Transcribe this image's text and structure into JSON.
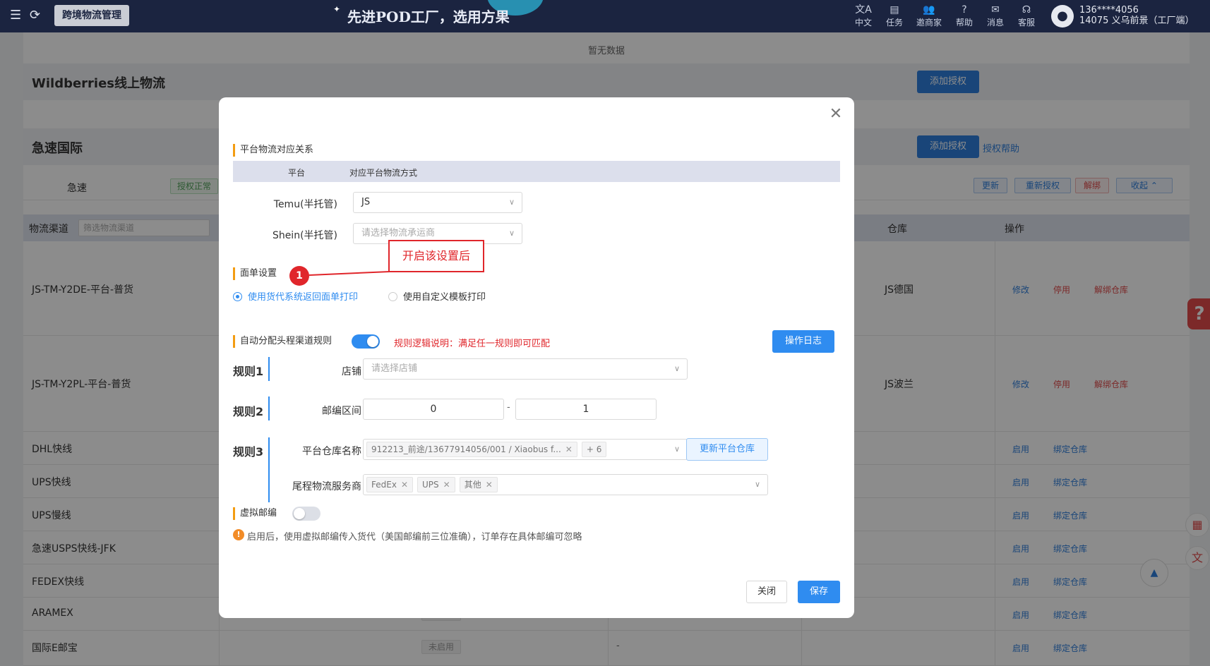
{
  "topbar": {
    "page_tab": "跨境物流管理",
    "banner": "先进POD工厂，选用方果",
    "icons": [
      {
        "name": "language-icon",
        "glyph": "文A",
        "label": "中文"
      },
      {
        "name": "task-icon",
        "glyph": "▤",
        "label": "任务"
      },
      {
        "name": "invite-icon",
        "glyph": "👥",
        "label": "邀商家"
      },
      {
        "name": "help-icon",
        "glyph": "?",
        "label": "帮助"
      },
      {
        "name": "message-icon",
        "glyph": "✉",
        "label": "消息"
      },
      {
        "name": "service-icon",
        "glyph": "☊",
        "label": "客服"
      }
    ],
    "user_phone": "136****4056",
    "user_shop": "14075 义乌前景（工厂端）"
  },
  "background": {
    "nodata": "暂无数据",
    "wildberries_title": "Wildberries线上物流",
    "add_auth": "添加授权",
    "jisu_title": "急速国际",
    "auth_help": "授权帮助",
    "auth_name": "急速",
    "auth_status": "授权正常",
    "btn_update": "更新",
    "btn_reauth": "重新授权",
    "btn_unbind": "解绑",
    "btn_collapse": "收起",
    "col_channel": "物流渠道",
    "filter_placeholder": "筛选物流渠道",
    "col_warehouse": "仓库",
    "col_action": "操作",
    "rows": [
      {
        "name": "JS-TM-Y2DE-平台-普货",
        "warehouse": "JS德国",
        "a1": "修改",
        "a2": "停用",
        "a3": "解绑仓库"
      },
      {
        "name": "JS-TM-Y2PL-平台-普货",
        "warehouse": "JS波兰",
        "a1": "修改",
        "a2": "停用",
        "a3": "解绑仓库"
      },
      {
        "name": "DHL快线",
        "a1": "启用",
        "a2": "绑定仓库"
      },
      {
        "name": "UPS快线",
        "a1": "启用",
        "a2": "绑定仓库"
      },
      {
        "name": "UPS慢线",
        "a1": "启用",
        "a2": "绑定仓库"
      },
      {
        "name": "急速USPS快线-JFK",
        "a1": "启用",
        "a2": "绑定仓库"
      },
      {
        "name": "FEDEX快线",
        "a1": "启用",
        "a2": "绑定仓库"
      },
      {
        "name": "ARAMEX",
        "status": "未启用",
        "dash": "-",
        "a1": "启用",
        "a2": "绑定仓库"
      },
      {
        "name": "国际E邮宝",
        "status": "未启用",
        "dash": "-",
        "a1": "启用",
        "a2": "绑定仓库"
      }
    ]
  },
  "modal": {
    "sec_mapping": "平台物流对应关系",
    "col_platform": "平台",
    "col_method": "对应平台物流方式",
    "temu_label": "Temu(半托管)",
    "temu_value": "JS",
    "shein_label": "Shein(半托管)",
    "shein_placeholder": "请选择物流承运商",
    "sec_label": "面单设置",
    "radio_system": "使用货代系统返回面单打印",
    "radio_custom": "使用自定义模板打印",
    "sec_auto": "自动分配头程渠道规则",
    "auto_enabled": true,
    "rule_logic": "规则逻辑说明：满足任一规则即可匹配",
    "op_log": "操作日志",
    "rule1": "规则1",
    "shop_label": "店铺",
    "shop_placeholder": "请选择店铺",
    "rule2": "规则2",
    "zip_label": "邮编区间",
    "zip_from": "0",
    "zip_sep": "-",
    "zip_to": "1",
    "rule3": "规则3",
    "wh_label": "平台仓库名称",
    "wh_chip": "912213_前途/13677914056/001 / Xiaobus f...",
    "wh_more": "+ 6",
    "update_wh": "更新平台仓库",
    "carrier_label": "尾程物流服务商",
    "carriers": [
      "FedEx",
      "UPS",
      "其他"
    ],
    "sec_virtual": "虚拟邮编",
    "virtual_enabled": false,
    "virtual_note": "启用后，使用虚拟邮编传入货代（美国邮编前三位准确），订单存在具体邮编可忽略",
    "btn_close": "关闭",
    "btn_save": "保存"
  },
  "annotation": {
    "number": "1",
    "text": "开启该设置后"
  },
  "colors": {
    "accent": "#2f8cf0",
    "danger": "#e0262b",
    "topbar": "#1b2440"
  }
}
